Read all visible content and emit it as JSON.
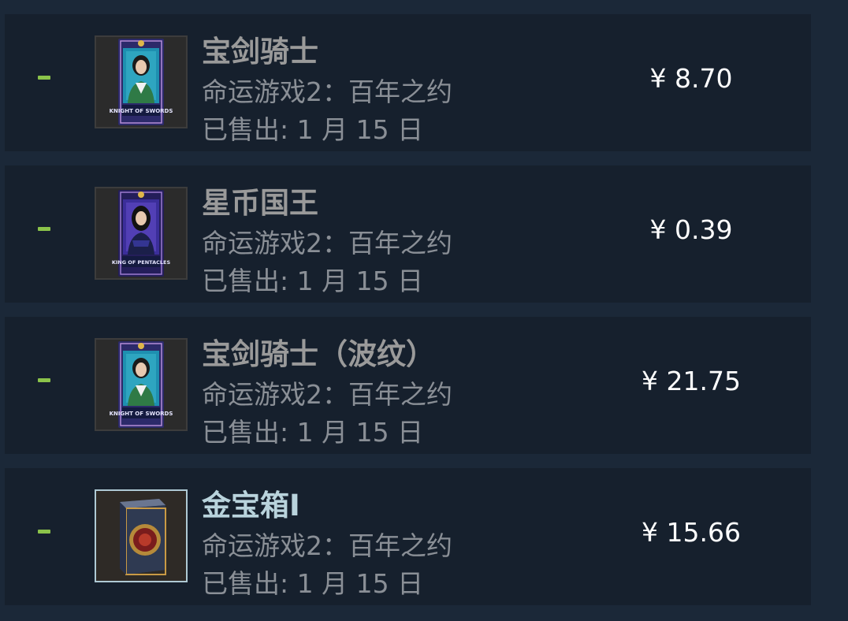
{
  "items": [
    {
      "name": "宝剑骑士",
      "game": "命运游戏2：百年之约",
      "sold": "已售出: 1 月 15 日",
      "price": "¥ 8.70",
      "card_caption": "KNIGHT OF SWORDS",
      "image": "tarot-card-knight-of-swords"
    },
    {
      "name": "星币国王",
      "game": "命运游戏2：百年之约",
      "sold": "已售出: 1 月 15 日",
      "price": "¥ 0.39",
      "card_caption": "KING OF PENTACLES",
      "image": "tarot-card-king-of-pentacles"
    },
    {
      "name": "宝剑骑士（波纹）",
      "game": "命运游戏2：百年之约",
      "sold": "已售出: 1 月 15 日",
      "price": "¥ 21.75",
      "card_caption": "KNIGHT OF SWORDS",
      "image": "tarot-card-knight-of-swords"
    },
    {
      "name": "金宝箱I",
      "game": "命运游戏2：百年之约",
      "sold": "已售出: 1 月 15 日",
      "price": "¥ 15.66",
      "image": "golden-treasure-box"
    }
  ],
  "colors": {
    "background": "#1b2838",
    "row": "#16202d",
    "status_dash": "#8bc34a",
    "price": "#ffffff"
  }
}
